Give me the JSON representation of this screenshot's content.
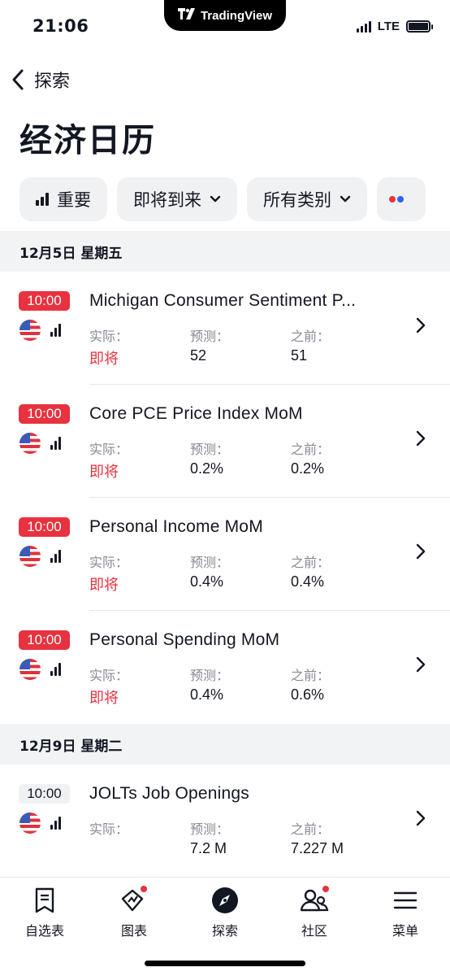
{
  "status_bar": {
    "time": "21:06",
    "app_name": "TradingView",
    "network": "LTE"
  },
  "nav": {
    "back_label": "探索"
  },
  "page_title": "经济日历",
  "filters": [
    {
      "label": "重要",
      "icon": "importance-bars-icon"
    },
    {
      "label": "即将到来",
      "icon": "chevron-down-icon"
    },
    {
      "label": "所有类别",
      "icon": "chevron-down-icon"
    }
  ],
  "columns": {
    "actual": "实际：",
    "forecast": "预测：",
    "previous": "之前："
  },
  "days": [
    {
      "header": "12月5日 星期五",
      "events": [
        {
          "time": "10:00",
          "title": "Michigan Consumer Sentiment P...",
          "actual": "即将",
          "forecast": "52",
          "previous": "51"
        },
        {
          "time": "10:00",
          "title": "Core PCE Price Index MoM",
          "actual": "即将",
          "forecast": "0.2%",
          "previous": "0.2%"
        },
        {
          "time": "10:00",
          "title": "Personal Income MoM",
          "actual": "即将",
          "forecast": "0.4%",
          "previous": "0.4%"
        },
        {
          "time": "10:00",
          "title": "Personal Spending MoM",
          "actual": "即将",
          "forecast": "0.4%",
          "previous": "0.6%"
        }
      ]
    },
    {
      "header": "12月9日 星期二",
      "events": [
        {
          "time": "10:00",
          "title": "JOLTs Job Openings",
          "actual": "",
          "forecast": "7.2 M",
          "previous": "7.227 M"
        }
      ]
    }
  ],
  "tabs": [
    {
      "label": "自选表",
      "icon": "watchlist-icon"
    },
    {
      "label": "图表",
      "icon": "chart-icon"
    },
    {
      "label": "探索",
      "icon": "compass-icon"
    },
    {
      "label": "社区",
      "icon": "community-icon"
    },
    {
      "label": "菜单",
      "icon": "menu-icon"
    }
  ],
  "colors": {
    "accent_red": "#e8323f",
    "chip_bg": "#f0f1f3",
    "section_bg": "#f2f3f5",
    "muted_text": "#868993"
  }
}
